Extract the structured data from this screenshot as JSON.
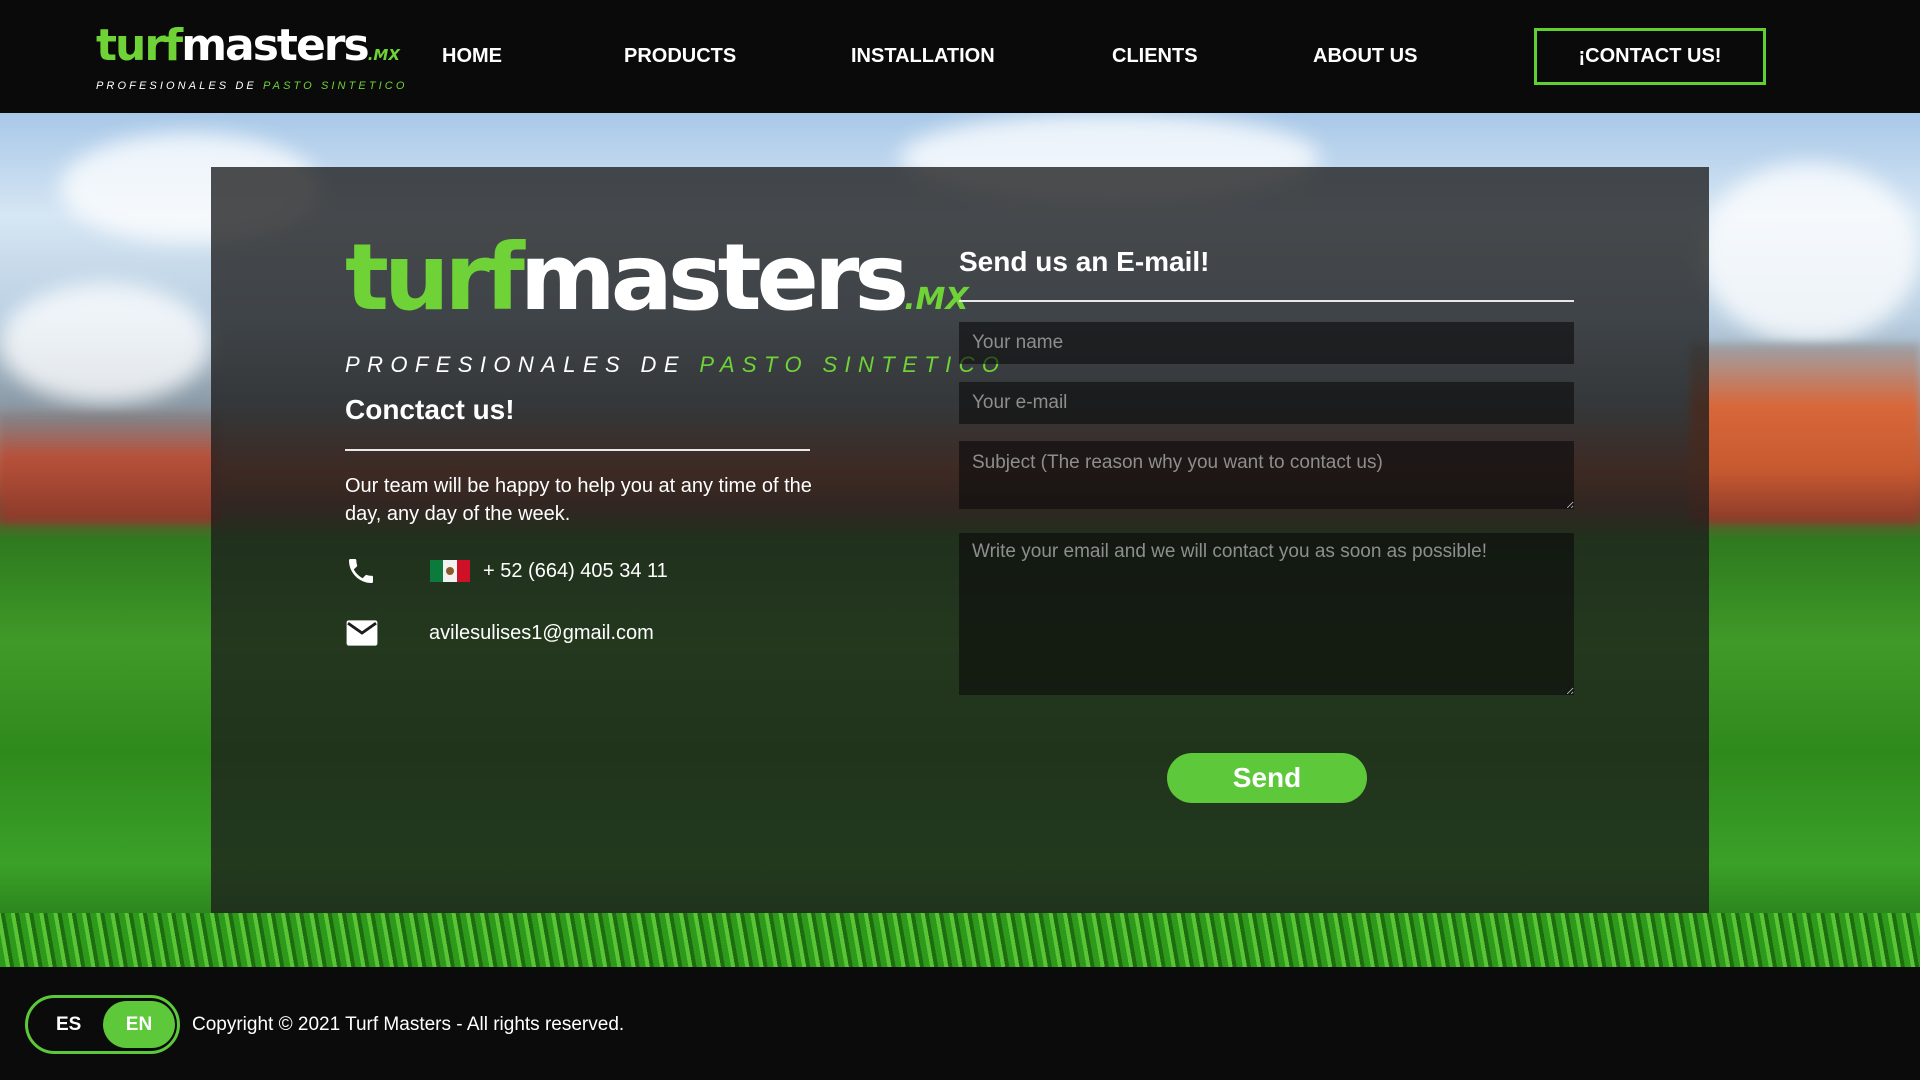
{
  "header": {
    "logo": {
      "word_white": "turf",
      "word_green_part": "masters",
      "suffix": ".MX",
      "tagline_white": "PROFESIONALES DE ",
      "tagline_green": "PASTO SINTETICO"
    },
    "nav": [
      "HOME",
      "PRODUCTS",
      "INSTALLATION",
      "CLIENTS",
      "ABOUT US"
    ],
    "cta_label": "¡CONTACT US!"
  },
  "main": {
    "logo": {
      "word_green": "turf",
      "word_white": "masters",
      "suffix": ".MX",
      "tagline_white": "PROFESIONALES DE ",
      "tagline_green": "PASTO SINTETICO"
    },
    "left_title": "Conctact us!",
    "left_description": "Our team will be happy to help you at any time of the day, any day of the week.",
    "phone": "+ 52 (664) 405 34 11",
    "email": "avilesulises1@gmail.com",
    "form": {
      "title": "Send us an E-mail!",
      "name_placeholder": "Your name",
      "email_placeholder": "Your e-mail",
      "subject_placeholder": "Subject (The reason why you want to contact us)",
      "message_placeholder": "Write your email and we will contact you as soon as possible!",
      "send_label": "Send"
    }
  },
  "footer": {
    "lang_es": "ES",
    "lang_en": "EN",
    "active_lang": "EN",
    "copyright": "Copyright © 2021 Turf Masters - All rights reserved."
  },
  "colors": {
    "accent": "#5cc83a",
    "logo_green": "#6fd236",
    "header_bg": "#0a0a0a",
    "panel_bg": "#1c1c1c"
  },
  "icons": [
    "phone-icon",
    "mexico-flag-icon",
    "mail-icon"
  ]
}
